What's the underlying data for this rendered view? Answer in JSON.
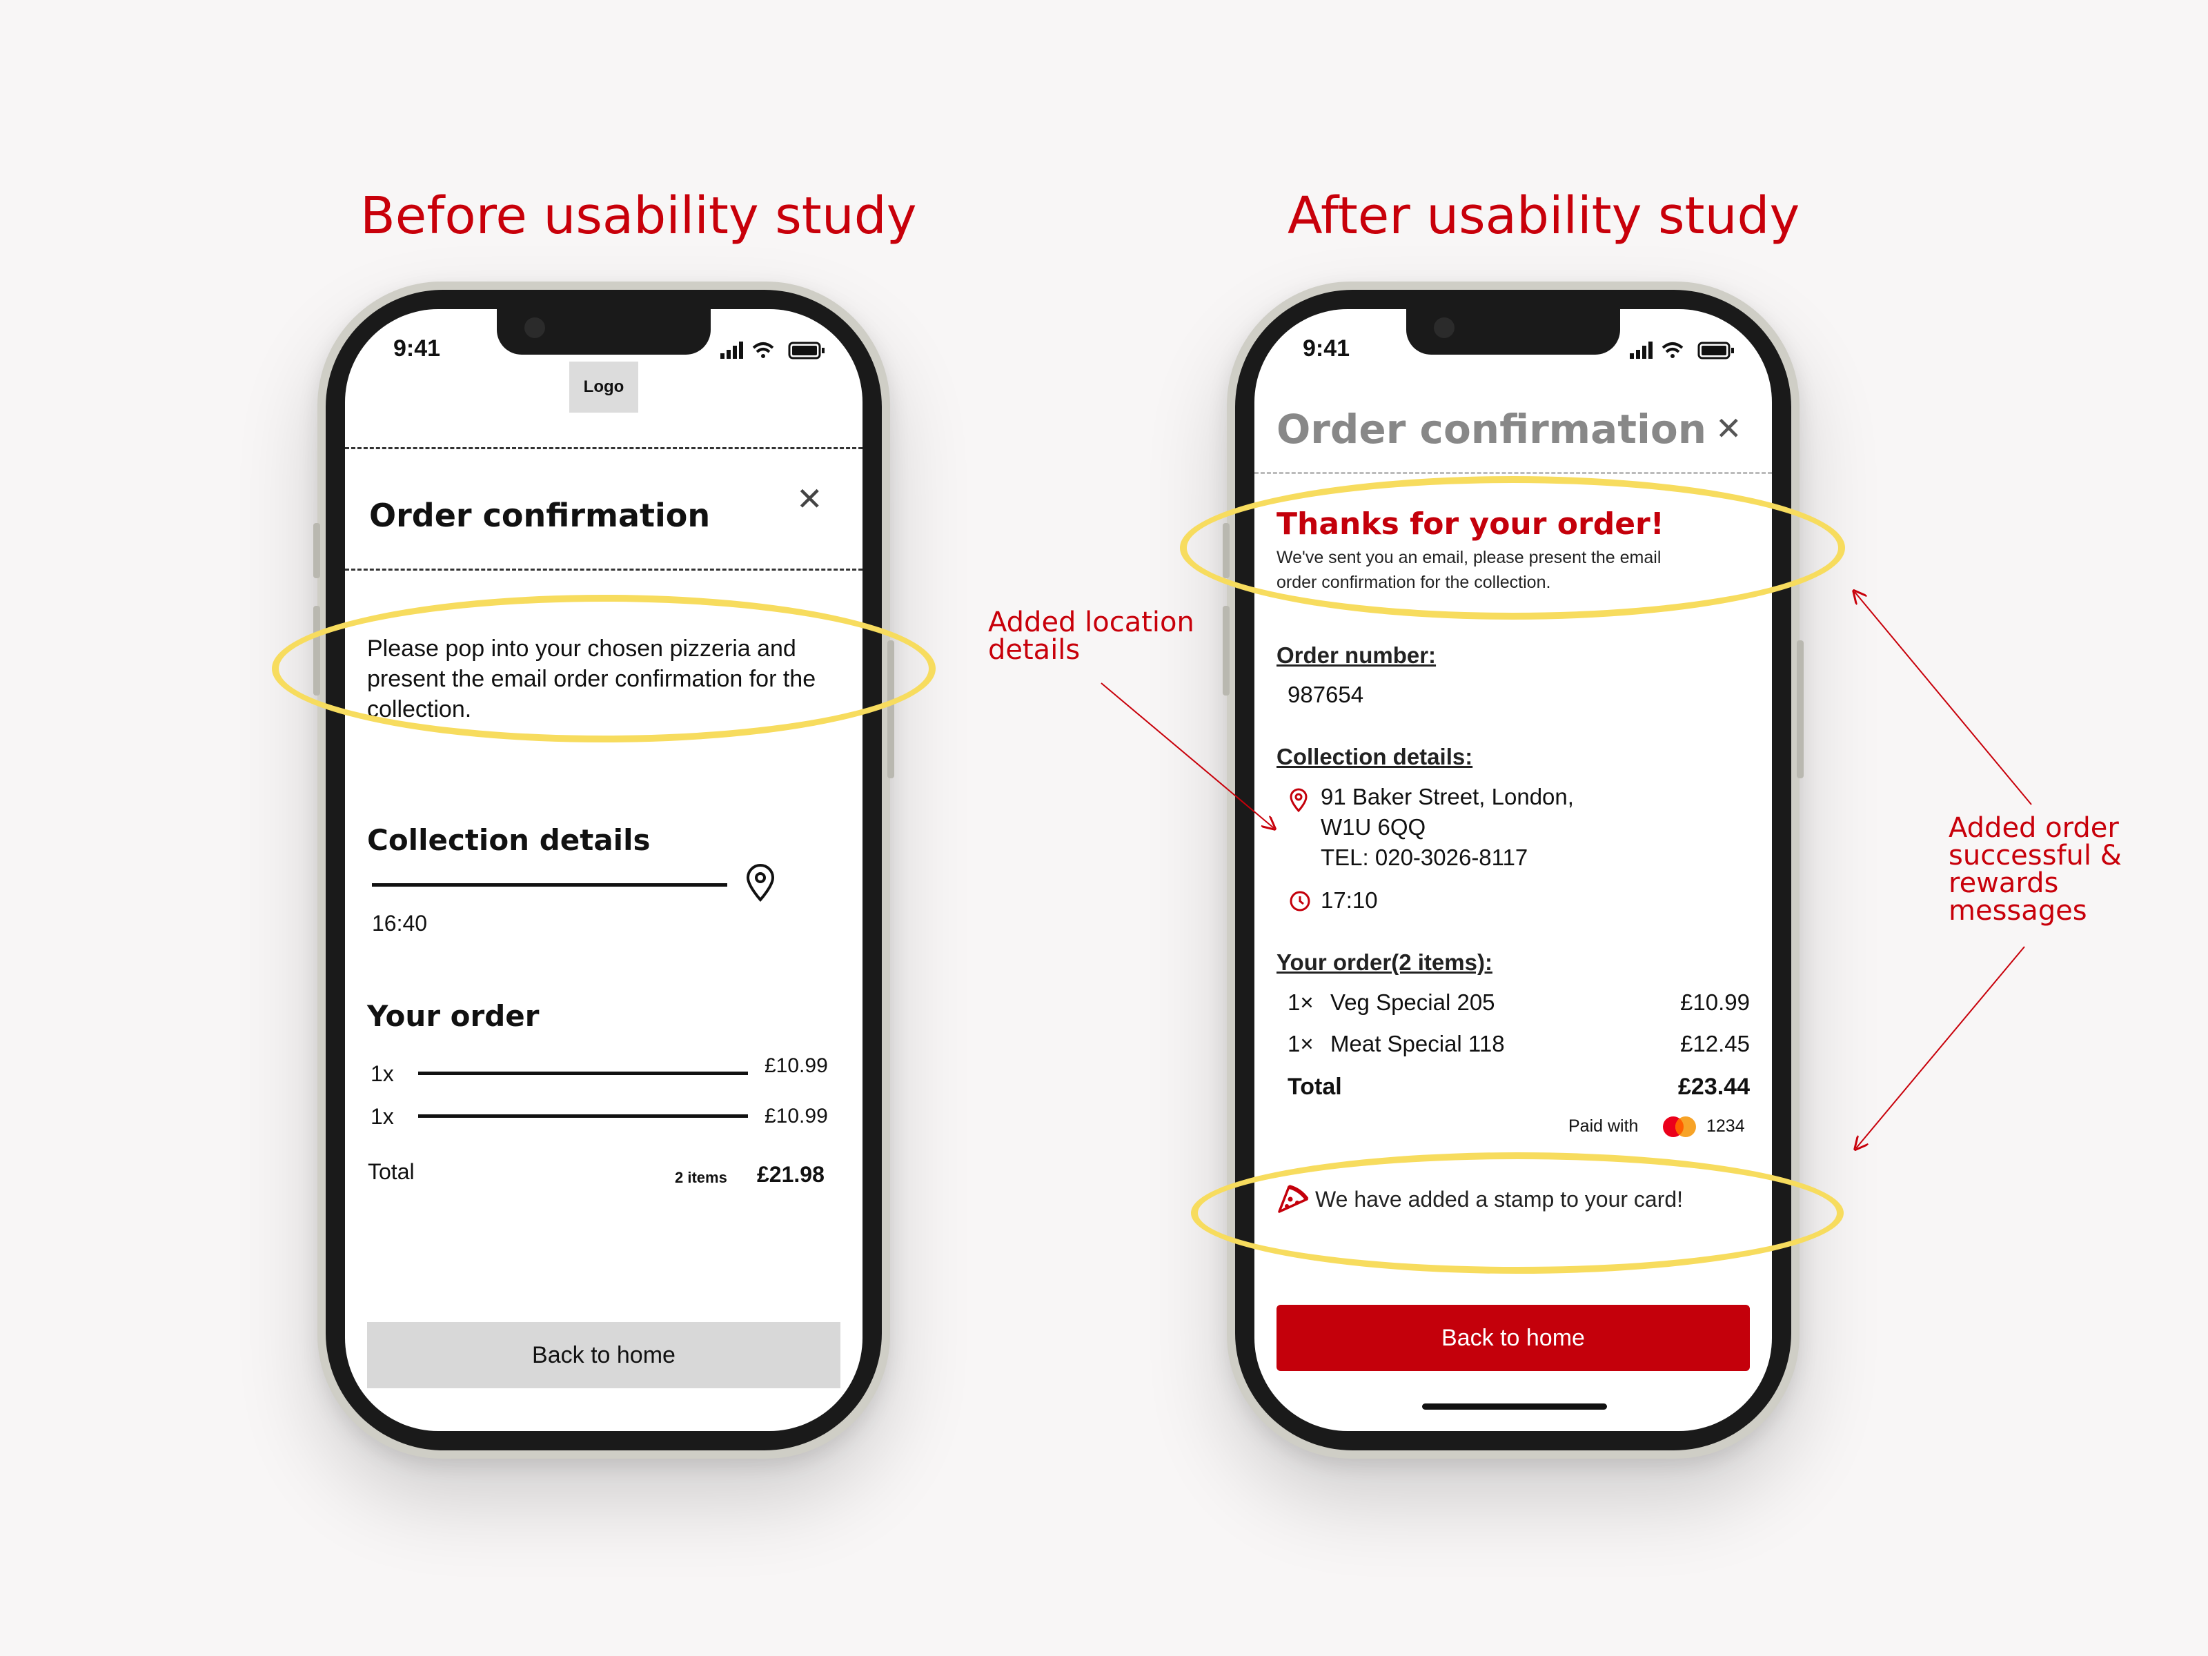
{
  "headings": {
    "before": "Before usability study",
    "after": "After usability study"
  },
  "before": {
    "status_time": "9:41",
    "logo": "Logo",
    "title": "Order confirmation",
    "message": "Please pop into your chosen pizzeria and present the email order confirmation for the collection.",
    "collection_title": "Collection details",
    "collection_time": "16:40",
    "order_title": "Your order",
    "items": [
      {
        "qty": "1x",
        "price": "£10.99"
      },
      {
        "qty": "1x",
        "price": "£10.99"
      }
    ],
    "total_label": "Total",
    "items_count": "2 items",
    "total": "£21.98",
    "back_button": "Back  to home"
  },
  "after": {
    "status_time": "9:41",
    "title": "Order confirmation",
    "thanks_title": "Thanks for your order!",
    "thanks_text_1": "We've sent you an email, please present the email",
    "thanks_text_2": "order confirmation for the collection.",
    "order_number_label": "Order number:",
    "order_number": "987654",
    "collection_label": "Collection details:",
    "address_1": "91 Baker Street, London,",
    "address_2": "W1U 6QQ",
    "phone": "TEL: 020-3026-8117",
    "time": "17:10",
    "your_order_label": "Your order(2 items):",
    "items": [
      {
        "qty": "1×",
        "name": "Veg Special 205",
        "price": "£10.99"
      },
      {
        "qty": "1×",
        "name": "Meat Special 118",
        "price": "£12.45"
      }
    ],
    "total_label": "Total",
    "total": "£23.44",
    "paid_with": "Paid with",
    "card_last4": "1234",
    "stamp_message": "We have added a stamp to your card!",
    "back_button": "Back to home"
  },
  "annotations": {
    "location": [
      "Added location",
      "details"
    ],
    "messages": [
      "Added order",
      "successful &",
      "rewards",
      "messages"
    ]
  },
  "colors": {
    "accent": "#c4000b",
    "highlight": "#f7dc5e"
  },
  "icons": [
    "location-pin-icon",
    "clock-icon",
    "pizza-icon",
    "mastercard-icon",
    "close-icon",
    "signal-icon",
    "wifi-icon",
    "battery-icon"
  ]
}
